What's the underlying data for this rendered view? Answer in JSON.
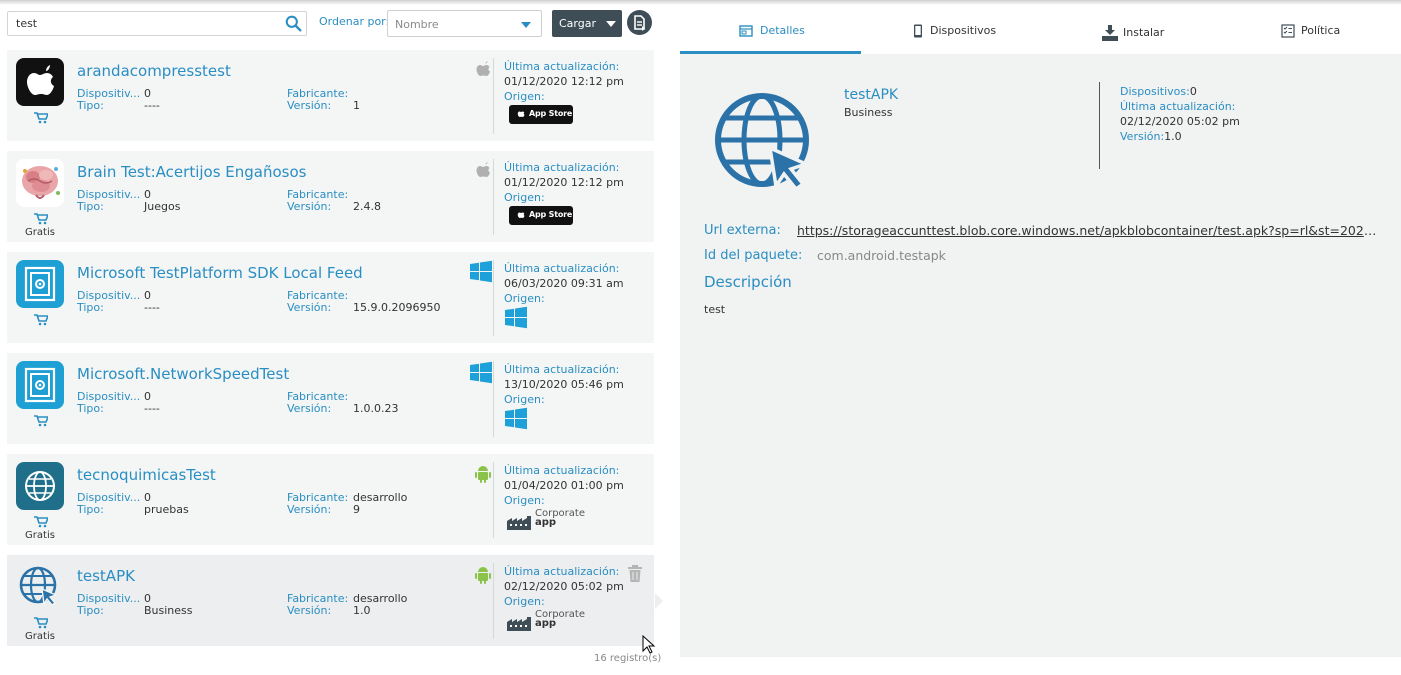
{
  "colors": {
    "accent": "#2a8ec2",
    "dark_button": "#3f4d57",
    "card_bg": "#f4f6f6",
    "panel_bg": "#f1f2f2"
  },
  "toolbar": {
    "search_value": "test",
    "sort_label": "Ordenar por:",
    "sort_selected": "Nombre",
    "load_button": "Cargar"
  },
  "apps": [
    {
      "name": "arandacompresstest",
      "devices_label": "Dispositiv...",
      "devices": "0",
      "type_label": "Tipo:",
      "type": "----",
      "maker_label": "Fabricante:",
      "maker": "",
      "version_label": "Versión:",
      "version": "1",
      "platform_icon": "apple-icon",
      "updated_label": "Última actualización:",
      "updated": "01/12/2020 12:12 pm",
      "origin_label": "Origen:",
      "origin": "App Store",
      "price": ""
    },
    {
      "name": "Brain Test:Acertijos Engañosos",
      "devices_label": "Dispositiv...",
      "devices": "0",
      "type_label": "Tipo:",
      "type": "Juegos",
      "maker_label": "Fabricante:",
      "maker": "",
      "version_label": "Versión:",
      "version": "2.4.8",
      "platform_icon": "apple-icon",
      "updated_label": "Última actualización:",
      "updated": "01/12/2020 12:12 pm",
      "origin_label": "Origen:",
      "origin": "App Store",
      "price": "Gratis"
    },
    {
      "name": "Microsoft TestPlatform SDK Local Feed",
      "devices_label": "Dispositiv...",
      "devices": "0",
      "type_label": "Tipo:",
      "type": "----",
      "maker_label": "Fabricante:",
      "maker": "",
      "version_label": "Versión:",
      "version": "15.9.0.2096950",
      "platform_icon": "windows-icon",
      "updated_label": "Última actualización:",
      "updated": "06/03/2020 09:31 am",
      "origin_label": "Origen:",
      "origin": "windows-store",
      "price": ""
    },
    {
      "name": "Microsoft.NetworkSpeedTest",
      "devices_label": "Dispositiv...",
      "devices": "0",
      "type_label": "Tipo:",
      "type": "----",
      "maker_label": "Fabricante:",
      "maker": "",
      "version_label": "Versión:",
      "version": "1.0.0.23",
      "platform_icon": "windows-icon",
      "updated_label": "Última actualización:",
      "updated": "13/10/2020 05:46 pm",
      "origin_label": "Origen:",
      "origin": "windows-store",
      "price": ""
    },
    {
      "name": "tecnoquimicasTest",
      "devices_label": "Dispositiv...",
      "devices": "0",
      "type_label": "Tipo:",
      "type": "pruebas",
      "maker_label": "Fabricante:",
      "maker": "desarrollo",
      "version_label": "Versión:",
      "version": "9",
      "platform_icon": "android-icon",
      "updated_label": "Última actualización:",
      "updated": "01/04/2020 01:00 pm",
      "origin_label": "Origen:",
      "origin": "Corporate app",
      "price": "Gratis"
    },
    {
      "name": "testAPK",
      "devices_label": "Dispositiv...",
      "devices": "0",
      "type_label": "Tipo:",
      "type": "Business",
      "maker_label": "Fabricante:",
      "maker": "desarrollo",
      "version_label": "Versión:",
      "version": "1.0",
      "platform_icon": "android-icon",
      "updated_label": "Última actualización:",
      "updated": "02/12/2020 05:02 pm",
      "origin_label": "Origen:",
      "origin": "Corporate app",
      "price": "Gratis"
    }
  ],
  "corporate_badge": {
    "line1": "Corporate",
    "line2": "app"
  },
  "appstore_badge": "App Store",
  "records": "16 registro(s)",
  "tabs": [
    {
      "label": "Detalles",
      "icon": "details-icon"
    },
    {
      "label": "Dispositivos",
      "icon": "device-icon"
    },
    {
      "label": "Instalar",
      "icon": "install-icon"
    },
    {
      "label": "Política",
      "icon": "policy-icon"
    }
  ],
  "detail": {
    "name": "testAPK",
    "category": "Business",
    "devices_label": "Dispositivos:",
    "devices": "0",
    "updated_label": "Última actualización:",
    "updated": "02/12/2020 05:02 pm",
    "version_label": "Versión:",
    "version": "1.0",
    "url_label": "Url externa:",
    "url": "https://storageaccunttest.blob.core.windows.net/apkblobcontainer/test.apk?sp=rl&st=2020-12-...",
    "package_label": "Id del paquete:",
    "package": "com.android.testapk",
    "description_label": "Descripción",
    "description": "test"
  }
}
